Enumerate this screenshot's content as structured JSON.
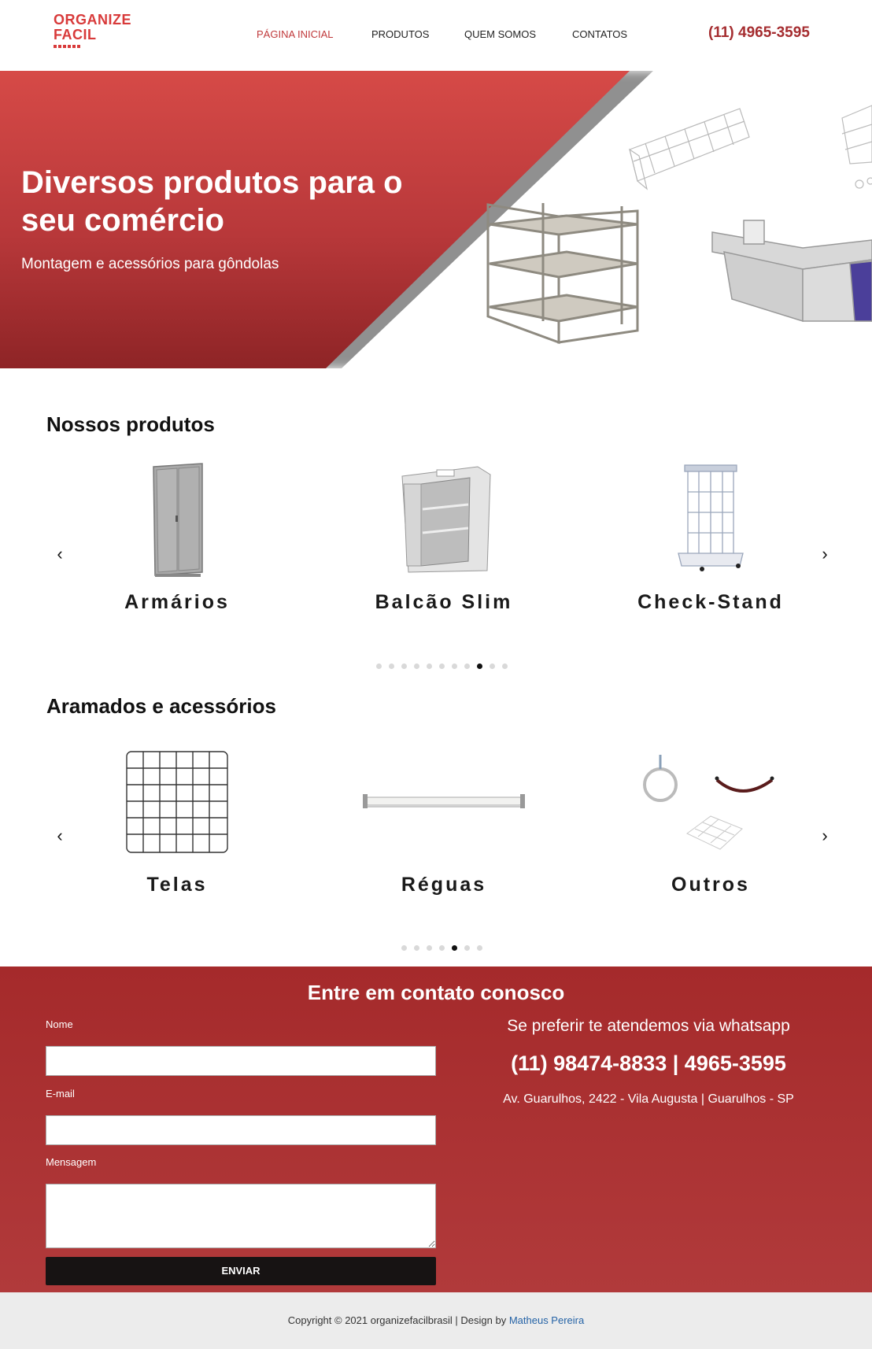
{
  "brand": {
    "logo_line1": "ORGANIZE",
    "logo_line2": "FACIL"
  },
  "nav": {
    "items": [
      {
        "label": "PÁGINA INICIAL",
        "active": true
      },
      {
        "label": "PRODUTOS"
      },
      {
        "label": "QUEM SOMOS"
      },
      {
        "label": "CONTATOS"
      }
    ],
    "phone": "(11) 4965-3595"
  },
  "hero": {
    "title": "Diversos produtos para o seu comércio",
    "subtitle": "Montagem e acessórios para gôndolas"
  },
  "products": {
    "title": "Nossos produtos",
    "items": [
      {
        "label": "Armários",
        "icon": "cabinet-icon"
      },
      {
        "label": "Balcão Slim",
        "icon": "counter-cabinet-icon"
      },
      {
        "label": "Check-Stand",
        "icon": "wire-rack-icon"
      }
    ],
    "dots_total": 11,
    "active_dot": 9
  },
  "accessories": {
    "title": "Aramados e acessórios",
    "items": [
      {
        "label": "Telas",
        "icon": "wire-grid-icon"
      },
      {
        "label": "Réguas",
        "icon": "bar-rail-icon"
      },
      {
        "label": "Outros",
        "icon": "hooks-accessories-icon"
      }
    ],
    "dots_total": 7,
    "active_dot": 5
  },
  "contact": {
    "title": "Entre em contato conosco",
    "name_label": "Nome",
    "email_label": "E-mail",
    "message_label": "Mensagem",
    "send_label": "ENVIAR",
    "whatsapp_text": "Se preferir te atendemos via whatsapp",
    "phones": "(11) 98474-8833 | 4965-3595",
    "address": "Av. Guarulhos, 2422 - Vila Augusta | Guarulhos - SP"
  },
  "footer": {
    "copyright": "Copyright © 2021 organizefacilbrasil | Design by",
    "designer": "Matheus Pereira"
  },
  "colors": {
    "brand_red": "#d83a3a",
    "dark_red": "#a52a2b",
    "button_dark": "#171313",
    "link_blue": "#2563a6"
  }
}
